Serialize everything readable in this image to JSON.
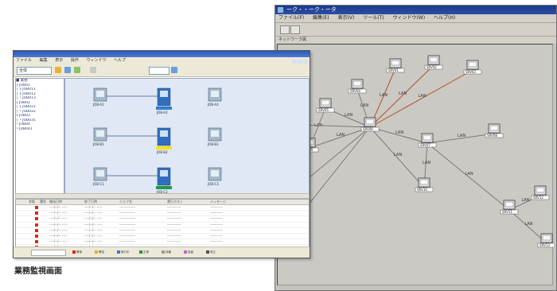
{
  "caption": "業務監視画面",
  "network_window": {
    "title": "ーク・・ーク・ータ",
    "menu": [
      "ファイル(F)",
      "編集(E)",
      "表示(V)",
      "ツール(T)",
      "ウィンドウ(W)",
      "ヘルプ(H)"
    ],
    "tab_label": "ネットワーク図",
    "node_labels": [
      "SRV01",
      "SRV02",
      "SRV03",
      "SRV04",
      "SRV05",
      "SRV06",
      "SRV07",
      "SRV08",
      "SRV09",
      "SRV10",
      "SRV11",
      "SRV12",
      "SRV13"
    ],
    "link_labels": [
      "LAN",
      "LAN",
      "LAN",
      "LAN",
      "LAN",
      "LAN",
      "LAN",
      "LAN",
      "LAN",
      "LAN",
      "LAN",
      "LAN",
      "LAN",
      "LAN"
    ],
    "colors": {
      "link": "#7a7a7a",
      "link_accent": "#b0502a",
      "node_fill": "#ffffff"
    }
  },
  "job_window": {
    "menu": [
      "ファイル",
      "編集",
      "表示",
      "操作",
      "ウィンドウ",
      "ヘルプ"
    ],
    "toolbar_field": "全体",
    "tree_items": [
      "■ 業務",
      "├ JOB01",
      "│ ├ JOB011",
      "│ ├ JOB012",
      "│ └ JOB013",
      "├ JOB02",
      "│ ├ JOB021",
      "│ └ JOB022",
      "├ JOB03",
      "│ └ JOB031",
      "└ JOB04",
      "  └ JOB041"
    ],
    "flow_labels": [
      "JOB-A1",
      "JOB-A2",
      "JOB-A3",
      "JOB-B1",
      "JOB-B2",
      "JOB-B3",
      "JOB-C1",
      "JOB-C2",
      "JOB-C3"
    ],
    "flow_colors": {
      "running": "#2f7fd6",
      "warning": "#f2e21a",
      "ended": "#1f9a4a",
      "pane": "#dfe8f4"
    },
    "grid_headers": [
      "",
      "状態",
      "種別",
      "開始日時",
      "終了日時",
      "ジョブ名",
      "実行ホスト",
      "メッセージ"
    ],
    "grid_rows": [
      [
        "",
        "",
        "",
        "----/--/-- --:--",
        "----/--/-- --:--",
        "--------------",
        "------------",
        "-----------"
      ],
      [
        "",
        "",
        "",
        "----/--/-- --:--",
        "----/--/-- --:--",
        "--------------",
        "------------",
        "-----------"
      ],
      [
        "",
        "",
        "",
        "----/--/-- --:--",
        "----/--/-- --:--",
        "--------------",
        "------------",
        "-----------"
      ],
      [
        "",
        "",
        "",
        "----/--/-- --:--",
        "----/--/-- --:--",
        "--------------",
        "------------",
        "-----------"
      ],
      [
        "",
        "",
        "",
        "----/--/-- --:--",
        "----/--/-- --:--",
        "--------------",
        "------------",
        "-----------"
      ],
      [
        "",
        "",
        "",
        "----/--/-- --:--",
        "----/--/-- --:--",
        "--------------",
        "------------",
        "-----------"
      ],
      [
        "",
        "",
        "",
        "----/--/-- --:--",
        "----/--/-- --:--",
        "--------------",
        "------------",
        "-----------"
      ],
      [
        "",
        "",
        "",
        "----/--/-- --:--",
        "----/--/-- --:--",
        "--------------",
        "------------",
        "-----------"
      ]
    ],
    "status_chips": [
      {
        "label": "異常",
        "color": "#d42a1c"
      },
      {
        "label": "警告",
        "color": "#e8b21a"
      },
      {
        "label": "実行中",
        "color": "#2f7fd6"
      },
      {
        "label": "正常",
        "color": "#1f9a4a"
      },
      {
        "label": "待機",
        "color": "#9a9a9a"
      },
      {
        "label": "保留",
        "color": "#b06ad0"
      },
      {
        "label": "停止",
        "color": "#555555"
      }
    ]
  }
}
